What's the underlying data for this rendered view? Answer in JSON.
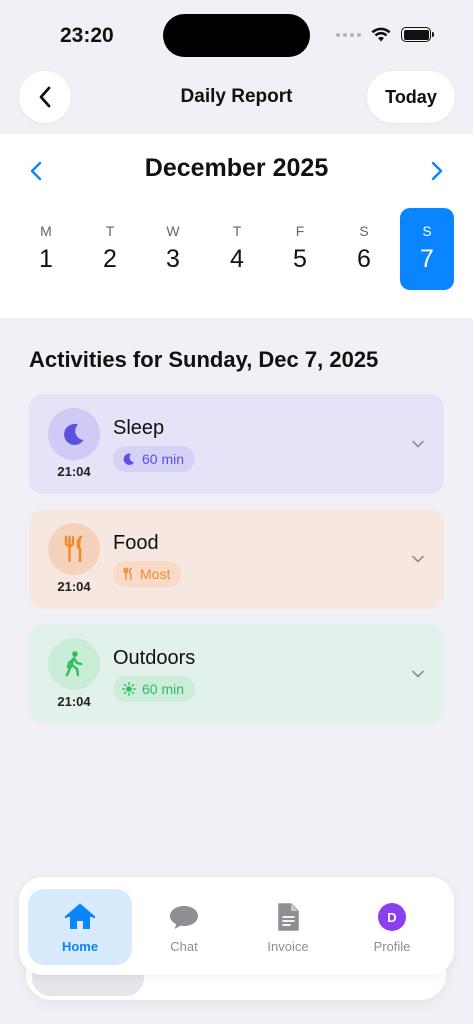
{
  "status_bar": {
    "time": "23:20"
  },
  "nav": {
    "title": "Daily Report",
    "today_label": "Today"
  },
  "calendar": {
    "month_label": "December 2025",
    "days": [
      {
        "name": "M",
        "num": "1"
      },
      {
        "name": "T",
        "num": "2"
      },
      {
        "name": "W",
        "num": "3"
      },
      {
        "name": "T",
        "num": "4"
      },
      {
        "name": "F",
        "num": "5"
      },
      {
        "name": "S",
        "num": "6"
      },
      {
        "name": "S",
        "num": "7"
      }
    ],
    "selected_day": "7"
  },
  "activities": {
    "heading": "Activities for Sunday, Dec 7, 2025",
    "items": [
      {
        "title": "Sleep",
        "time": "21:04",
        "badge": "60 min",
        "icon": "moon-icon",
        "color": "#5b50e0"
      },
      {
        "title": "Food",
        "time": "21:04",
        "badge": "Most",
        "icon": "fork-knife-icon",
        "color": "#f08a2a"
      },
      {
        "title": "Outdoors",
        "time": "21:04",
        "badge": "60 min",
        "icon": "walking-icon",
        "color": "#2fbc5a"
      }
    ]
  },
  "tab_bar": {
    "tabs": [
      {
        "label": "Home",
        "icon": "house-icon"
      },
      {
        "label": "Chat",
        "icon": "chat-bubble-icon"
      },
      {
        "label": "Invoice",
        "icon": "document-icon"
      },
      {
        "label": "Profile",
        "icon": "avatar"
      }
    ],
    "avatar_initial": "D",
    "active": "Home"
  },
  "colors": {
    "accent": "#0a84ff",
    "background": "#f1f0f6"
  }
}
